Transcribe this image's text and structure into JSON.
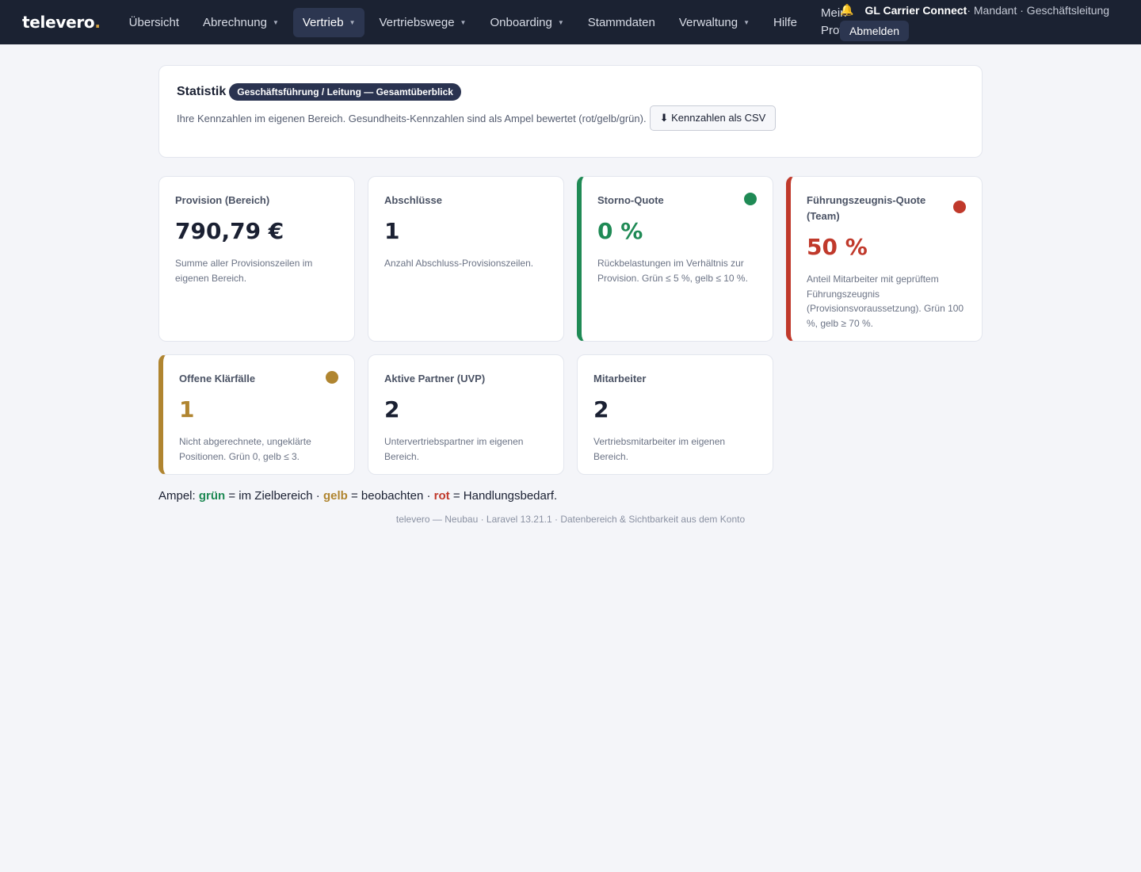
{
  "brand": {
    "name": "televero",
    "dot": "."
  },
  "nav": [
    {
      "label": "Übersicht",
      "dropdown": false,
      "active": false
    },
    {
      "label": "Abrechnung",
      "dropdown": true,
      "active": false
    },
    {
      "label": "Vertrieb",
      "dropdown": true,
      "active": true
    },
    {
      "label": "Vertriebswege",
      "dropdown": true,
      "active": false
    },
    {
      "label": "Onboarding",
      "dropdown": true,
      "active": false
    },
    {
      "label": "Stammdaten",
      "dropdown": false,
      "active": false
    },
    {
      "label": "Verwaltung",
      "dropdown": true,
      "active": false
    },
    {
      "label": "Hilfe",
      "dropdown": false,
      "active": false
    }
  ],
  "profile_link": "Mein Profil",
  "user": {
    "bell_icon": "bell-icon",
    "org": "GL Carrier Connect",
    "meta": " · Mandant · Geschäftsleitung",
    "logout": "Abmelden"
  },
  "intro": {
    "title": "Statistik",
    "badge": "Geschäftsführung / Leitung — Gesamtüberblick",
    "subtitle": "Ihre Kennzahlen im eigenen Bereich. Gesundheits-Kennzahlen sind als Ampel bewertet (rot/gelb/grün).",
    "csv_button": "⬇ Kennzahlen als CSV"
  },
  "kpis": [
    {
      "label": "Provision (Bereich)",
      "value": "790,79 €",
      "desc": "Summe aller Provisionszeilen im eigenen Bereich.",
      "status": "none"
    },
    {
      "label": "Abschlüsse",
      "value": "1",
      "desc": "Anzahl Abschluss-Provisionszeilen.",
      "status": "none"
    },
    {
      "label": "Storno-Quote",
      "value": "0 %",
      "desc": "Rückbelastungen im Verhältnis zur Provision. Grün ≤ 5 %, gelb ≤ 10 %.",
      "status": "green"
    },
    {
      "label": "Führungszeugnis-Quote (Team)",
      "value": "50 %",
      "desc": "Anteil Mitarbeiter mit geprüftem Führungszeugnis (Provisionsvoraussetzung). Grün 100 %, gelb ≥ 70 %.",
      "status": "red"
    },
    {
      "label": "Offene Klärfälle",
      "value": "1",
      "desc": "Nicht abgerechnete, ungeklärte Positionen. Grün 0, gelb ≤ 3.",
      "status": "yellow"
    },
    {
      "label": "Aktive Partner (UVP)",
      "value": "2",
      "desc": "Untervertriebspartner im eigenen Bereich.",
      "status": "none"
    },
    {
      "label": "Mitarbeiter",
      "value": "2",
      "desc": "Vertriebsmitarbeiter im eigenen Bereich.",
      "status": "none"
    }
  ],
  "legend": {
    "prefix": "Ampel: ",
    "green": "grün",
    "green_text": " = im Zielbereich · ",
    "yellow": "gelb",
    "yellow_text": " = beobachten · ",
    "red": "rot",
    "red_text": " = Handlungsbedarf."
  },
  "footer": "televero — Neubau · Laravel 13.21.1 · Datenbereich & Sichtbarkeit aus dem Konto",
  "colors": {
    "topbar": "#1b2232",
    "green": "#1f8a55",
    "yellow": "#b08530",
    "red": "#c0392b"
  }
}
